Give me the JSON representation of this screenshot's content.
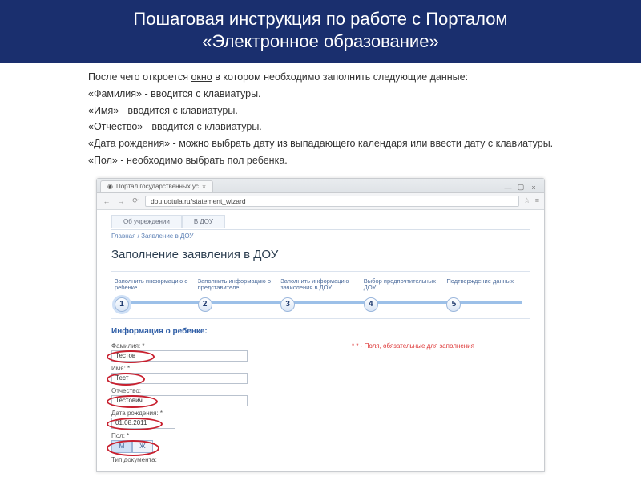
{
  "slide": {
    "title_line1": "Пошаговая инструкция по работе с Порталом",
    "title_line2": "«Электронное образование»"
  },
  "instructions": {
    "intro_prefix": "После чего откроется ",
    "intro_underlined": "окно",
    "intro_suffix": " в котором необходимо заполнить следующие данные:",
    "line_surname": "«Фамилия» - вводится с клавиатуры.",
    "line_name": "«Имя» - вводится с клавиатуры.",
    "line_patronymic": "«Отчество» - вводится с клавиатуры.",
    "line_dob": "«Дата рождения» - можно выбрать дату из выпадающего календаря или ввести дату с клавиатуры.",
    "line_gender": "«Пол» - необходимо выбрать пол ребенка."
  },
  "browser": {
    "tab_title": "Портал государственных ус",
    "url": "dou.uotula.ru/statement_wizard",
    "site_tab_1": "Об учреждении",
    "site_tab_2": "В ДОУ",
    "breadcrumb": "Главная / Заявление в ДОУ",
    "page_heading": "Заполнение заявления в ДОУ"
  },
  "wizard": {
    "step1": {
      "num": "1",
      "label": "Заполнить информацию о ребенке"
    },
    "step2": {
      "num": "2",
      "label": "Заполнить информацию о представителе"
    },
    "step3": {
      "num": "3",
      "label": "Заполнить информацию зачисления в ДОУ"
    },
    "step4": {
      "num": "4",
      "label": "Выбор предпочтительных ДОУ"
    },
    "step5": {
      "num": "5",
      "label": "Подтверждение данных"
    }
  },
  "form": {
    "section_title": "Информация о ребенке:",
    "required_note": "* - Поля, обязательные для заполнения",
    "surname_label": "Фамилия: *",
    "surname_value": "Тестов",
    "name_label": "Имя: *",
    "name_value": "Тест",
    "patronymic_label": "Отчество:",
    "patronymic_value": "Тестович",
    "dob_label": "Дата рождения: *",
    "dob_value": "01.08.2011",
    "gender_label": "Пол: *",
    "gender_m": "М",
    "gender_f": "Ж",
    "doc_type_label": "Тип документа:"
  }
}
